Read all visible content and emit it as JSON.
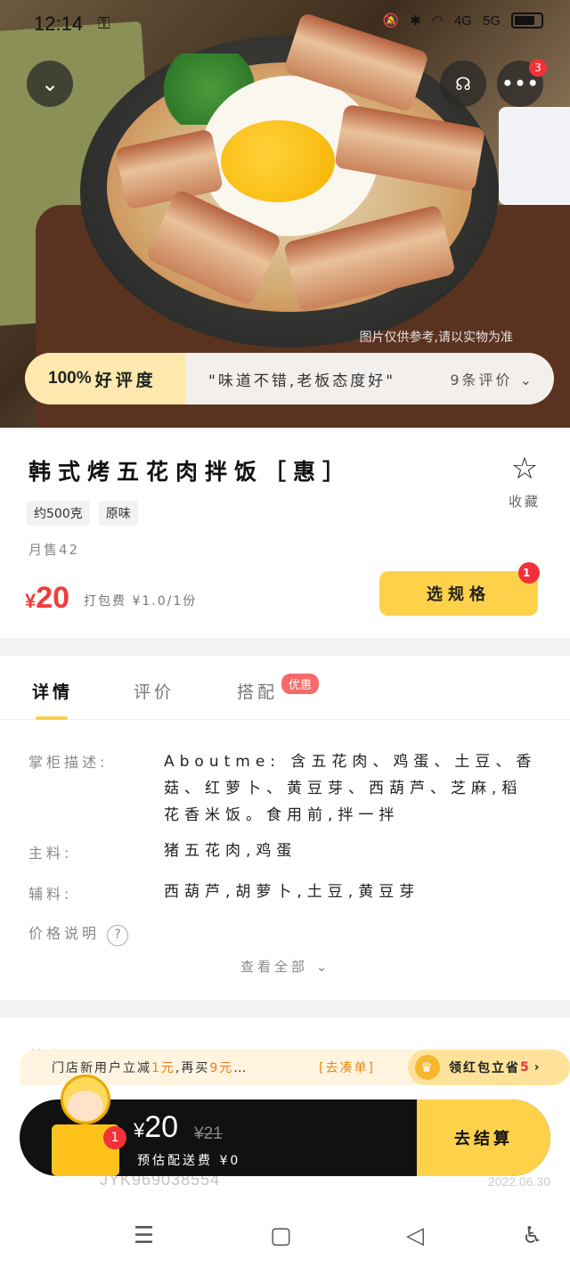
{
  "status_bar": {
    "time": "12:14",
    "net1": "4G",
    "net2": "5G"
  },
  "hero": {
    "disclaimer": "图片仅供参考,请以实物为准"
  },
  "top_buttons": {
    "more_badge": "3"
  },
  "rating": {
    "percent": "100%",
    "label": "好评度",
    "quote": "\"味道不错,老板态度好\"",
    "count": "9条评价"
  },
  "product": {
    "name": "韩式烤五花肉拌饭［惠］",
    "favorite_label": "收藏",
    "tags": [
      "约500克",
      "原味"
    ],
    "monthly_sales": "月售42",
    "price_symbol": "¥",
    "price": "20",
    "packing_fee": "打包费 ¥1.0/1份",
    "spec_button": "选规格",
    "spec_badge": "1"
  },
  "tabs": {
    "detail": "详情",
    "review": "评价",
    "combo": "搭配",
    "combo_tag": "优惠"
  },
  "details": {
    "desc_label": "掌柜描述:",
    "desc_value": "Aboutme: 含五花肉、鸡蛋、土豆、香菇、红萝卜、黄豆芽、西葫芦、芝麻,稻花香米饭。食用前,拌一拌",
    "main_label": "主料:",
    "main_value": "猪五花肉,鸡蛋",
    "aux_label": "辅料:",
    "aux_value": "西葫芦,胡萝卜,土豆,黄豆芽",
    "price_label": "价格说明",
    "view_all": "查看全部"
  },
  "reviews": {
    "section_title": "外卖评价",
    "user": "JYK969038554",
    "date": "2022.06.30"
  },
  "promo": {
    "text_prefix": "门店新用户立减",
    "amount1": "1元",
    "text_mid": ",再买",
    "amount2": "9元",
    "text_suffix": "…",
    "link": "[去凑单]",
    "redpack_label": "领红包立省",
    "redpack_amount": "5"
  },
  "checkout": {
    "symbol": "¥",
    "total": "20",
    "original": "¥21",
    "delivery": "预估配送费 ¥0",
    "cart_badge": "1",
    "pay_button": "去结算"
  }
}
